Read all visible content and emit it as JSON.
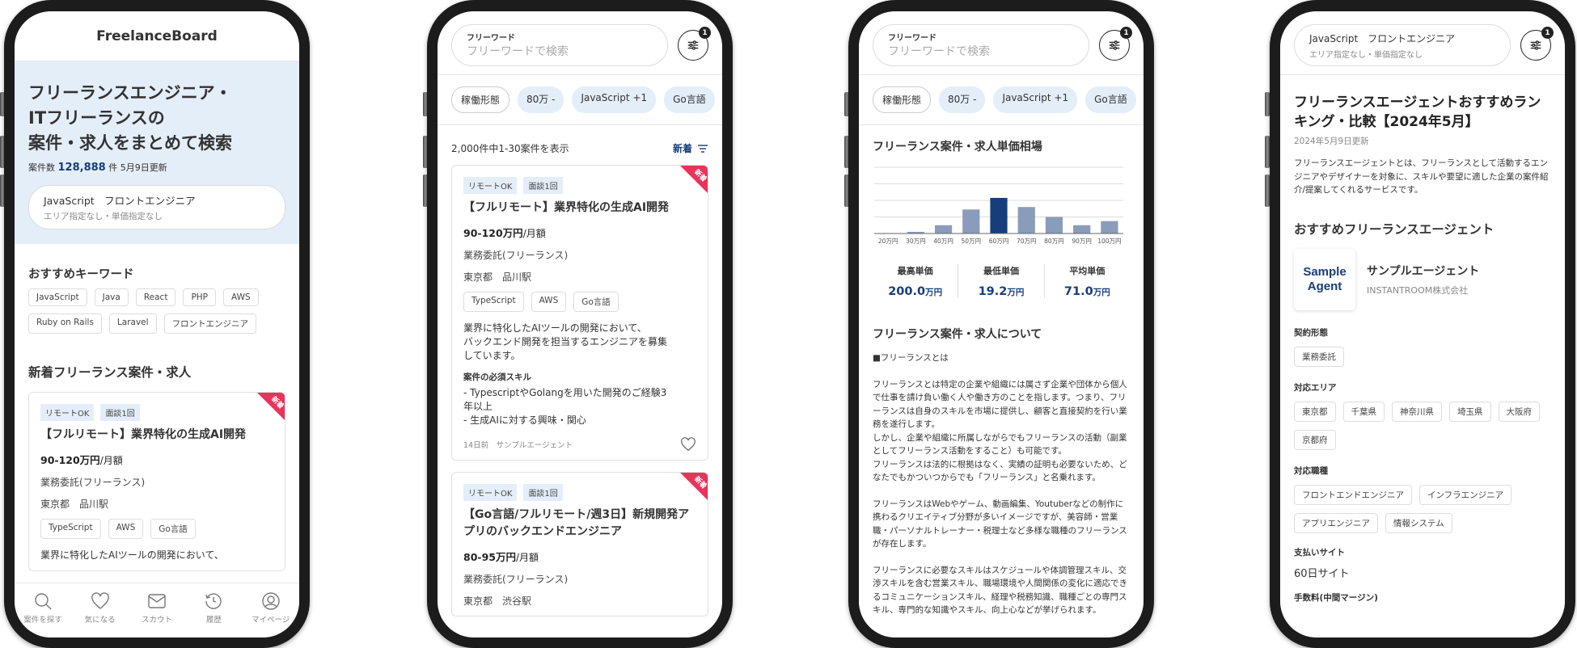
{
  "colors": {
    "brand_blue": "#173e7a",
    "hero_bg": "#e4eef9",
    "new_badge": "#e8345a",
    "bar_default": "#8a9cbb",
    "bar_highlight": "#173e7a"
  },
  "phone1": {
    "logo": "FreelanceBoard",
    "hero_title_lines": [
      "フリーランスエンジニア・",
      "ITフリーランスの",
      "案件・求人をまとめて検索"
    ],
    "count_prefix": "案件数",
    "count_value": "128,888",
    "count_suffix": "件",
    "updated": "5月9日更新",
    "condition_main": "JavaScript　フロントエンジニア",
    "condition_sub": "エリア指定なし・単価指定なし",
    "keywords_title": "おすすめキーワード",
    "keywords": [
      "JavaScript",
      "Java",
      "React",
      "PHP",
      "AWS",
      "Ruby on Rails",
      "Laravel",
      "フロントエンジニア"
    ],
    "new_jobs_title": "新着フリーランス案件・求人",
    "card": {
      "badge": "新着",
      "tags": [
        "リモートOK",
        "面談1回"
      ],
      "title": "【フルリモート】業界特化の生成AI開発",
      "price": "90-120万円",
      "price_unit": "/月額",
      "contract": "業務委託(フリーランス)",
      "location": "東京都　品川駅",
      "skills": [
        "TypeScript",
        "AWS",
        "Go言語"
      ],
      "desc": "業界に特化したAIツールの開発において、"
    },
    "nav": [
      {
        "label": "案件を探す",
        "icon": "search-icon"
      },
      {
        "label": "気になる",
        "icon": "heart-icon"
      },
      {
        "label": "スカウト",
        "icon": "mail-icon"
      },
      {
        "label": "履歴",
        "icon": "history-icon"
      },
      {
        "label": "マイページ",
        "icon": "user-icon"
      }
    ]
  },
  "search": {
    "label": "フリーワード",
    "placeholder": "フリーワードで検索",
    "filter_count": "1",
    "chips": [
      "稼働形態",
      "80万 -",
      "JavaScript +1",
      "Go言語"
    ]
  },
  "phone2": {
    "result_text": "2,000件中1-30案件を表示",
    "sort_label": "新着",
    "cards": [
      {
        "badge": "新着",
        "tags": [
          "リモートOK",
          "面談1回"
        ],
        "title": "【フルリモート】業界特化の生成AI開発",
        "price": "90-120万円",
        "price_unit": "/月額",
        "contract": "業務委託(フリーランス)",
        "location": "東京都　品川駅",
        "skills": [
          "TypeScript",
          "AWS",
          "Go言語"
        ],
        "desc": "業界に特化したAIツールの開発において、\nバックエンド開発を担当するエンジニアを募集\nしています。",
        "skill_heading": "案件の必須スキル",
        "skill_text": "- TypescriptやGolangを用いた開発のご経験3\n年以上\n- 生成AIに対する興味・関心",
        "posted": "14日前",
        "agent": "サンプルエージェント"
      },
      {
        "badge": "新着",
        "tags": [
          "リモートOK",
          "面談1回"
        ],
        "title": "【Go言語/フルリモート/週3日】新規開発アプリのバックエンドエンジニア",
        "price": "80-95万円",
        "price_unit": "/月額",
        "contract": "業務委託(フリーランス)",
        "location": "東京都　渋谷駅"
      }
    ]
  },
  "phone3": {
    "chart_title": "フリーランス案件・求人単価相場",
    "stats": [
      {
        "label": "最高単価",
        "value": "200.0",
        "unit": "万円"
      },
      {
        "label": "最低単価",
        "value": "19.2",
        "unit": "万円"
      },
      {
        "label": "平均単価",
        "value": "71.0",
        "unit": "万円"
      }
    ],
    "about_title": "フリーランス案件・求人について",
    "about_sub": "■フリーランスとは",
    "about_p1": "フリーランスとは特定の企業や組織には属さず企業や団体から個人で仕事を請け負い働く人や働き方のことを指します。つまり、フリーランスは自身のスキルを市場に提供し、顧客と直接契約を行い業務を遂行します。\nしかし、企業や組織に所属しながらでもフリーランスの活動（副業としてフリーランス活動をすること）も可能です。\nフリーランスは法的に根拠はなく、実績の証明も必要ないため、どなたでもかついつからでも「フリーランス」と名乗れます。",
    "about_p2": "フリーランスはWebやゲーム、動画編集、Youtuberなどの制作に携わるクリエイティブ分野が多いイメージですが、美容師・営業職・パーソナルトレーナー・税理士など多様な職種のフリーランスが存在します。",
    "about_p3": "フリーランスに必要なスキルはスケジュールや体調管理スキル、交渉スキルを含む営業スキル、職場環境や人間関係の変化に適応できるコミュニケーションスキル、経理や税務知識、職種ごとの専門スキル、専門的な知識やスキル、向上心などが挙げられます。"
  },
  "chart_data": {
    "type": "bar",
    "title": "フリーランス案件・求人単価相場",
    "categories": [
      "20万円",
      "30万円",
      "40万円",
      "50万円",
      "60万円",
      "70万円",
      "80万円",
      "90万円",
      "100万円"
    ],
    "values": [
      0,
      0.1,
      0.5,
      1.45,
      2.15,
      1.6,
      1.0,
      0.5,
      0.75
    ],
    "highlight_index": 4,
    "xlabel": "",
    "ylabel": "",
    "ylim": [
      0,
      4
    ],
    "grid": true,
    "legend": "none"
  },
  "phone4": {
    "condition_main": "JavaScript　フロントエンジニア",
    "condition_sub": "エリア指定なし・単価指定なし",
    "title": "フリーランスエージェントおすすめランキング・比較【2024年5月】",
    "updated": "2024年5月9日更新",
    "intro": "フリーランスエージェントとは、フリーランスとして活動するエンジニアやデザイナーを対象に、スキルや要望に適した企業の案件紹介/提案してくれるサービスです。",
    "section_title": "おすすめフリーランスエージェント",
    "agent_logo_lines": [
      "Sample",
      "Agent"
    ],
    "agent_name": "サンプルエージェント",
    "agent_company": "INSTANTROOM株式会社",
    "contract_label": "契約形態",
    "contract_chips": [
      "業務委託"
    ],
    "area_label": "対応エリア",
    "area_chips": [
      "東京都",
      "千葉県",
      "神奈川県",
      "埼玉県",
      "大阪府",
      "京都府"
    ],
    "job_label": "対応職種",
    "job_chips": [
      "フロントエンドエンジニア",
      "インフラエンジニア",
      "アプリエンジニア",
      "情報システム"
    ],
    "payment_label": "支払いサイト",
    "payment_value": "60日サイト",
    "fee_label": "手数料(中間マージン)"
  }
}
